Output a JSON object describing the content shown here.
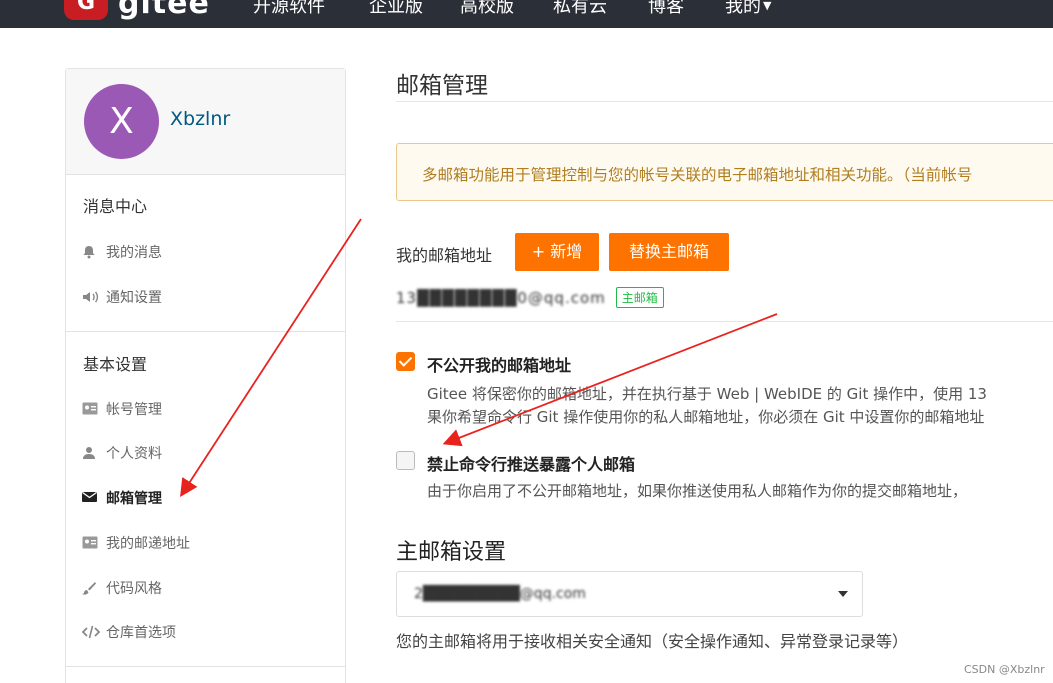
{
  "topnav": {
    "logo_letter": "G",
    "logo_text": "gitee",
    "items": [
      "开源软件",
      "企业版",
      "高校版",
      "私有云",
      "博客",
      "我的"
    ]
  },
  "sidebar": {
    "avatar_letter": "X",
    "avatar_color": "#9b59b6",
    "username": "Xbzlnr",
    "groups": [
      {
        "title": "消息中心",
        "items": [
          {
            "label": "我的消息",
            "icon": "bell-icon"
          },
          {
            "label": "通知设置",
            "icon": "volume-icon"
          }
        ]
      },
      {
        "title": "基本设置",
        "items": [
          {
            "label": "帐号管理",
            "icon": "id-card-icon"
          },
          {
            "label": "个人资料",
            "icon": "user-icon"
          },
          {
            "label": "邮箱管理",
            "icon": "envelope-icon",
            "active": true
          },
          {
            "label": "我的邮递地址",
            "icon": "address-card-icon"
          },
          {
            "label": "代码风格",
            "icon": "brush-icon"
          },
          {
            "label": "仓库首选项",
            "icon": "code-icon"
          }
        ]
      }
    ]
  },
  "main": {
    "title": "邮箱管理",
    "notice": "多邮箱功能用于管理控制与您的帐号关联的电子邮箱地址和相关功能。（当前帐号",
    "my_email_label": "我的邮箱地址",
    "add_button": "+ 新增",
    "switch_button": "替换主邮箱",
    "email_masked": "13████████0@qq.com",
    "primary_badge": "主邮箱",
    "options": [
      {
        "checked": true,
        "title": "不公开我的邮箱地址",
        "desc_line1": "Gitee 将保密你的邮箱地址，并在执行基于 Web | WebIDE 的 Git 操作中，使用 13",
        "desc_line2": "果你希望命令行 Git 操作使用你的私人邮箱地址，你必须在 Git 中设置你的邮箱地址"
      },
      {
        "checked": false,
        "title": "禁止命令行推送暴露个人邮箱",
        "desc_line1": "由于你启用了不公开邮箱地址，如果你推送使用私人邮箱作为你的提交邮箱地址，"
      }
    ],
    "primary_section_title": "主邮箱设置",
    "primary_select_value": "2█████████@qq.com",
    "primary_help": "您的主邮箱将用于接收相关安全通知（安全操作通知、异常登录记录等）"
  },
  "colors": {
    "accent": "#fe7300",
    "nav_bg": "#2b2f38",
    "annotation": "#e8231e"
  },
  "watermark": "CSDN @Xbzlnr"
}
